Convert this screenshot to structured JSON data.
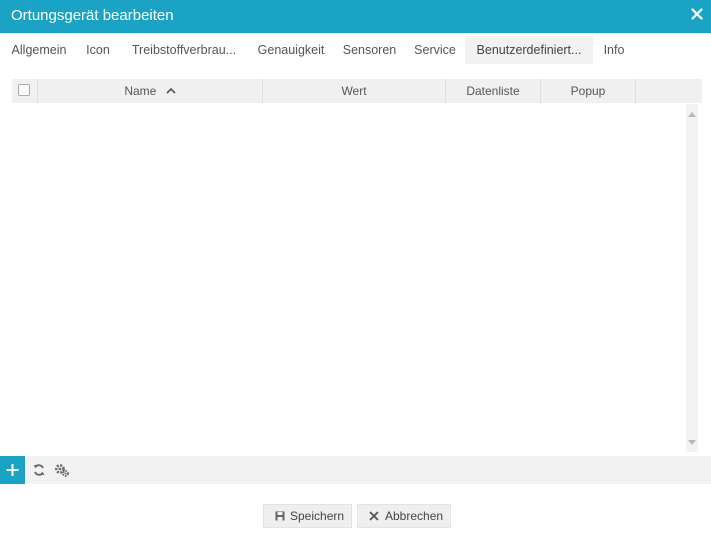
{
  "window": {
    "title": "Ortungsgerät bearbeiten",
    "close_icon": "close-icon"
  },
  "tabs": [
    {
      "label": "Allgemein",
      "active": false
    },
    {
      "label": "Icon",
      "active": false
    },
    {
      "label": "Treibstoffverbrau...",
      "active": false
    },
    {
      "label": "Genauigkeit",
      "active": false
    },
    {
      "label": "Sensoren",
      "active": false
    },
    {
      "label": "Service",
      "active": false
    },
    {
      "label": "Benutzerdefiniert...",
      "active": true
    },
    {
      "label": "Info",
      "active": false
    }
  ],
  "grid": {
    "columns": {
      "name": "Name",
      "value": "Wert",
      "datalist": "Datenliste",
      "popup": "Popup"
    },
    "sort": {
      "column": "Name",
      "direction": "ascending"
    },
    "rows": []
  },
  "toolbar": {
    "add_icon": "plus-icon",
    "refresh_icon": "refresh-icon",
    "settings_icon": "gears-icon"
  },
  "actions": {
    "save_label": "Speichern",
    "cancel_label": "Abbrechen"
  },
  "colors": {
    "accent": "#1aa3c4",
    "header_bg": "#f0f0f0",
    "active_tab_bg": "#f2f2f2"
  }
}
